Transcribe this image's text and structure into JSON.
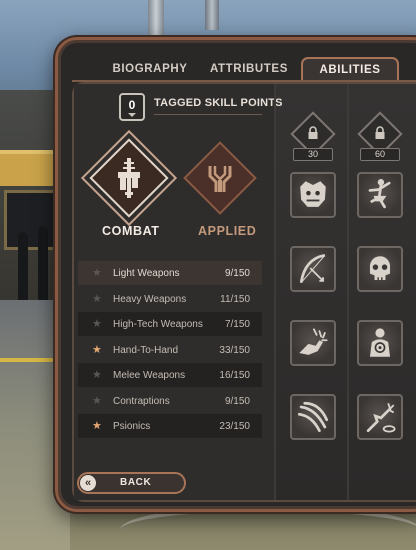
{
  "tabs": [
    {
      "label": "BIOGRAPHY",
      "active": false
    },
    {
      "label": "ATTRIBUTES",
      "active": false
    },
    {
      "label": "ABILITIES",
      "active": true
    }
  ],
  "tagged_skill_points": {
    "value": "0",
    "label": "TAGGED SKILL POINTS"
  },
  "categories": [
    {
      "label": "COMBAT",
      "selected": true,
      "icon": "combat-weapons-icon"
    },
    {
      "label": "APPLIED",
      "selected": false,
      "icon": "applied-tools-icon"
    }
  ],
  "skills": [
    {
      "name": "Light Weapons",
      "value": "9/150",
      "tagged": false,
      "highlight": true
    },
    {
      "name": "Heavy Weapons",
      "value": "11/150",
      "tagged": false,
      "highlight": false
    },
    {
      "name": "High-Tech Weapons",
      "value": "7/150",
      "tagged": false,
      "highlight": false
    },
    {
      "name": "Hand-To-Hand",
      "value": "33/150",
      "tagged": true,
      "highlight": false
    },
    {
      "name": "Melee Weapons",
      "value": "16/150",
      "tagged": false,
      "highlight": false
    },
    {
      "name": "Contraptions",
      "value": "9/150",
      "tagged": false,
      "highlight": false
    },
    {
      "name": "Psionics",
      "value": "23/150",
      "tagged": true,
      "highlight": false
    }
  ],
  "ability_tiers": [
    {
      "required": "30",
      "icon": "lock-icon"
    },
    {
      "required": "60",
      "icon": "lock-icon"
    }
  ],
  "abilities": [
    [
      "beast-face-icon",
      "dancer-icon"
    ],
    [
      "broken-bow-icon",
      "skull-icon"
    ],
    [
      "punch-impact-icon",
      "target-silhouette-icon"
    ],
    [
      "claw-slash-icon",
      "psionic-hand-icon"
    ]
  ],
  "back_button": {
    "label": "BACK",
    "icon": "chevron-left-icon"
  },
  "colors": {
    "accent": "#a87458",
    "tagged_star": "#e2a772",
    "panel": "#2a2827"
  }
}
